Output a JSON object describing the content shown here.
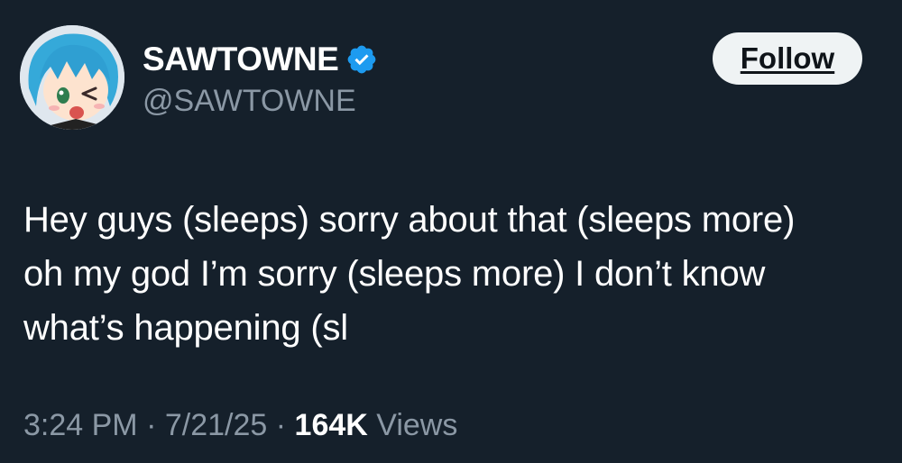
{
  "author": {
    "display_name": "SAWTOWNE",
    "handle": "@SAWTOWNE",
    "verified": true,
    "verified_color": "#1d9bf0"
  },
  "follow_button": {
    "label": "Follow"
  },
  "tweet": {
    "lines": [
      "Hey guys (sleeps) sorry about that (sleeps more)",
      "oh my god I’m sorry (sleeps more) I don’t know",
      "what’s happening (sl"
    ]
  },
  "meta": {
    "time": "3:24 PM",
    "separator": "·",
    "date": "7/21/25",
    "views_count": "164K",
    "views_label": "Views"
  },
  "colors": {
    "background": "#15202b",
    "secondary_text": "#8b98a5",
    "button_bg": "#eff3f4"
  }
}
